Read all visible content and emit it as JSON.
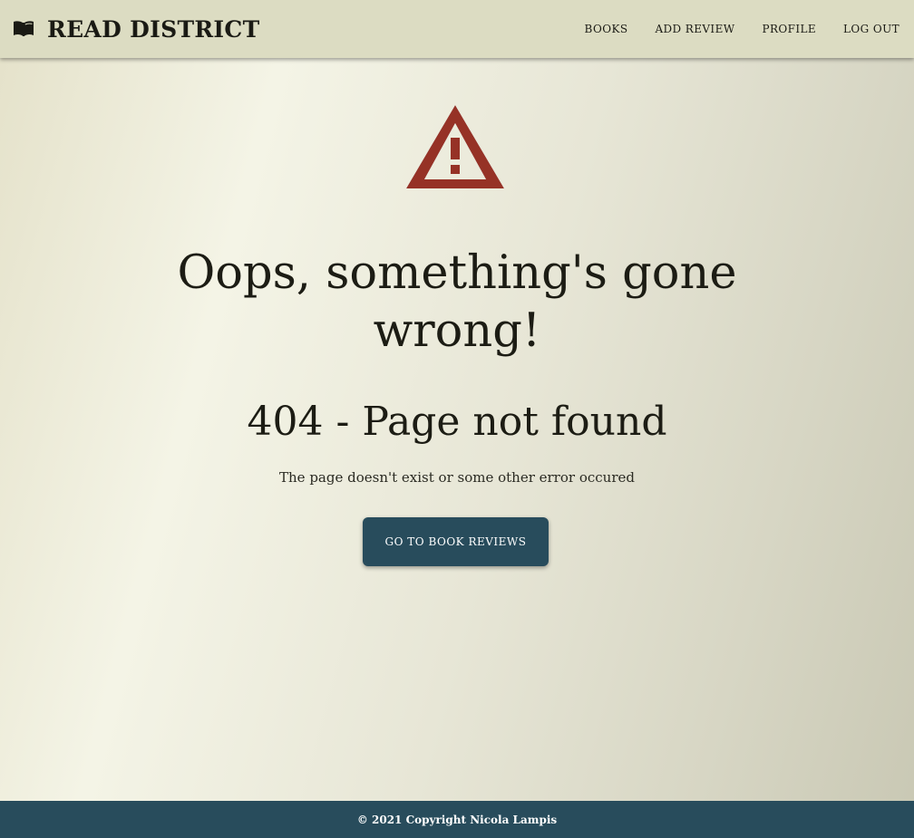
{
  "brand": {
    "icon": "book-open-icon",
    "name": "READ DISTRICT"
  },
  "nav": {
    "items": [
      {
        "label": "BOOKS"
      },
      {
        "label": "ADD REVIEW"
      },
      {
        "label": "PROFILE"
      },
      {
        "label": "LOG OUT"
      }
    ]
  },
  "error": {
    "icon": "warning-triangle-icon",
    "icon_color": "#963226",
    "headline": "Oops, something's gone wrong!",
    "code_title": "404 - Page not found",
    "message": "The page doesn't exist or some other error occured",
    "button_label": "GO TO BOOK REVIEWS"
  },
  "footer": {
    "text": "© 2021 Copyright Nicola Lampis"
  },
  "colors": {
    "navbar_bg": "#dcdcc2",
    "primary": "#284c5c",
    "warning": "#963226"
  }
}
